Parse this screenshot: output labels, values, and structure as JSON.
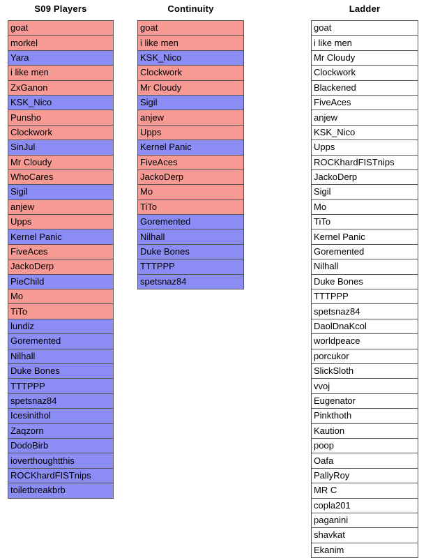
{
  "colors": {
    "red": "#f79a94",
    "blue": "#8c8cf5",
    "plain": "#ffffff",
    "border": "#555555",
    "text": "#000000"
  },
  "columns": [
    {
      "title": "S09 Players",
      "rows": [
        {
          "name": "goat",
          "fill": "red"
        },
        {
          "name": "morkel",
          "fill": "red"
        },
        {
          "name": "Yara",
          "fill": "blue"
        },
        {
          "name": "i like men",
          "fill": "red"
        },
        {
          "name": "ZxGanon",
          "fill": "red"
        },
        {
          "name": "KSK_Nico",
          "fill": "blue"
        },
        {
          "name": "Punsho",
          "fill": "red"
        },
        {
          "name": "Clockwork",
          "fill": "red"
        },
        {
          "name": "SinJul",
          "fill": "blue"
        },
        {
          "name": "Mr Cloudy",
          "fill": "red"
        },
        {
          "name": "WhoCares",
          "fill": "red"
        },
        {
          "name": "Sigil",
          "fill": "blue"
        },
        {
          "name": "anjew",
          "fill": "red"
        },
        {
          "name": "Upps",
          "fill": "red"
        },
        {
          "name": "Kernel Panic",
          "fill": "blue"
        },
        {
          "name": "FiveAces",
          "fill": "red"
        },
        {
          "name": "JackoDerp",
          "fill": "red"
        },
        {
          "name": "PieChild",
          "fill": "blue"
        },
        {
          "name": "Mo",
          "fill": "red"
        },
        {
          "name": "TiTo",
          "fill": "red"
        },
        {
          "name": "lundiz",
          "fill": "blue"
        },
        {
          "name": "Goremented",
          "fill": "blue"
        },
        {
          "name": "Nilhall",
          "fill": "blue"
        },
        {
          "name": "Duke Bones",
          "fill": "blue"
        },
        {
          "name": "TTTPPP",
          "fill": "blue"
        },
        {
          "name": "spetsnaz84",
          "fill": "blue"
        },
        {
          "name": "Icesinithol",
          "fill": "blue"
        },
        {
          "name": "Zaqzorn",
          "fill": "blue"
        },
        {
          "name": "DodoBirb",
          "fill": "blue"
        },
        {
          "name": "ioverthoughtthis",
          "fill": "blue"
        },
        {
          "name": "ROCKhardFISTnips",
          "fill": "blue"
        },
        {
          "name": "toiletbreakbrb",
          "fill": "blue"
        }
      ]
    },
    {
      "title": "Continuity",
      "rows": [
        {
          "name": "goat",
          "fill": "red"
        },
        {
          "name": "i like men",
          "fill": "red"
        },
        {
          "name": "KSK_Nico",
          "fill": "blue"
        },
        {
          "name": "Clockwork",
          "fill": "red"
        },
        {
          "name": "Mr Cloudy",
          "fill": "red"
        },
        {
          "name": "Sigil",
          "fill": "blue"
        },
        {
          "name": "anjew",
          "fill": "red"
        },
        {
          "name": "Upps",
          "fill": "red"
        },
        {
          "name": "Kernel Panic",
          "fill": "blue"
        },
        {
          "name": "FiveAces",
          "fill": "red"
        },
        {
          "name": "JackoDerp",
          "fill": "red"
        },
        {
          "name": "Mo",
          "fill": "red"
        },
        {
          "name": "TiTo",
          "fill": "red"
        },
        {
          "name": "Goremented",
          "fill": "blue"
        },
        {
          "name": "Nilhall",
          "fill": "blue"
        },
        {
          "name": "Duke Bones",
          "fill": "blue"
        },
        {
          "name": "TTTPPP",
          "fill": "blue"
        },
        {
          "name": "spetsnaz84",
          "fill": "blue"
        }
      ]
    },
    {
      "title": "Ladder",
      "rows": [
        {
          "name": "goat",
          "fill": "plain"
        },
        {
          "name": "i like men",
          "fill": "plain"
        },
        {
          "name": "Mr Cloudy",
          "fill": "plain"
        },
        {
          "name": "Clockwork",
          "fill": "plain"
        },
        {
          "name": "Blackened",
          "fill": "plain"
        },
        {
          "name": "FiveAces",
          "fill": "plain"
        },
        {
          "name": "anjew",
          "fill": "plain"
        },
        {
          "name": "KSK_Nico",
          "fill": "plain"
        },
        {
          "name": "Upps",
          "fill": "plain"
        },
        {
          "name": "ROCKhardFISTnips",
          "fill": "plain"
        },
        {
          "name": "JackoDerp",
          "fill": "plain"
        },
        {
          "name": "Sigil",
          "fill": "plain"
        },
        {
          "name": "Mo",
          "fill": "plain"
        },
        {
          "name": "TiTo",
          "fill": "plain"
        },
        {
          "name": "Kernel Panic",
          "fill": "plain"
        },
        {
          "name": "Goremented",
          "fill": "plain"
        },
        {
          "name": "Nilhall",
          "fill": "plain"
        },
        {
          "name": "Duke Bones",
          "fill": "plain"
        },
        {
          "name": "TTTPPP",
          "fill": "plain"
        },
        {
          "name": "spetsnaz84",
          "fill": "plain"
        },
        {
          "name": "DaolDnaKcol",
          "fill": "plain"
        },
        {
          "name": "worldpeace",
          "fill": "plain"
        },
        {
          "name": "porcukor",
          "fill": "plain"
        },
        {
          "name": "SlickSloth",
          "fill": "plain"
        },
        {
          "name": "vvoj",
          "fill": "plain"
        },
        {
          "name": "Eugenator",
          "fill": "plain"
        },
        {
          "name": "Pinkthoth",
          "fill": "plain"
        },
        {
          "name": "Kaution",
          "fill": "plain"
        },
        {
          "name": "poop",
          "fill": "plain"
        },
        {
          "name": "Oafa",
          "fill": "plain"
        },
        {
          "name": "PallyRoy",
          "fill": "plain"
        },
        {
          "name": "MR C",
          "fill": "plain"
        },
        {
          "name": "copla201",
          "fill": "plain"
        },
        {
          "name": "paganini",
          "fill": "plain"
        },
        {
          "name": "shavkat",
          "fill": "plain"
        },
        {
          "name": "Ekanim",
          "fill": "plain"
        }
      ]
    }
  ]
}
